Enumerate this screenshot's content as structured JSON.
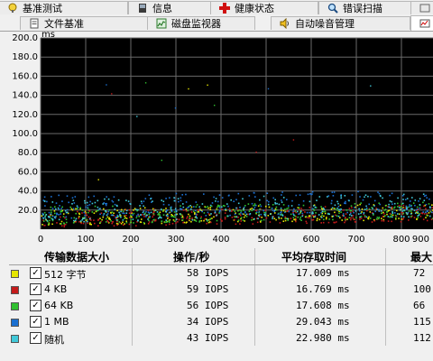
{
  "tabs_row1": [
    {
      "label": "基准测试",
      "icon": "benchmark-icon"
    },
    {
      "label": "信息",
      "icon": "info-icon"
    },
    {
      "label": "健康状态",
      "icon": "health-cross-icon"
    },
    {
      "label": "错误扫描",
      "icon": "magnifier-icon"
    },
    {
      "label": "",
      "icon": "small-tab-icon"
    }
  ],
  "tabs_row2": [
    {
      "label": "文件基准",
      "icon": "file-benchmark-icon"
    },
    {
      "label": "磁盘监视器",
      "icon": "disk-monitor-icon"
    },
    {
      "label": "自动噪音管理",
      "icon": "speaker-icon"
    },
    {
      "label": "",
      "icon": "chart-tab-icon"
    }
  ],
  "chart_data": {
    "type": "scatter",
    "ylabel": "ms",
    "ylim": [
      0,
      200
    ],
    "xlim": [
      0,
      870
    ],
    "y_ticks": [
      "200.0",
      "180.0",
      "160.0",
      "140.0",
      "120.0",
      "100.0",
      "80.0",
      "60.0",
      "40.0",
      "20.0"
    ],
    "x_ticks": [
      "0",
      "100",
      "200",
      "300",
      "400",
      "500",
      "600",
      "700",
      "800",
      "900"
    ],
    "grid": true,
    "background": "#000000",
    "series": [
      {
        "name": "512 字节",
        "color": "#e6e600",
        "y_range": [
          5,
          22
        ]
      },
      {
        "name": "4 KB",
        "color": "#c41a1a",
        "y_range": [
          3,
          20
        ]
      },
      {
        "name": "64 KB",
        "color": "#30c030",
        "y_range": [
          6,
          24
        ]
      },
      {
        "name": "1 MB",
        "color": "#1a6fd0",
        "y_range": [
          12,
          36
        ]
      },
      {
        "name": "随机",
        "color": "#40c8d8",
        "y_range": [
          8,
          32
        ]
      }
    ],
    "x_extent": [
      0,
      870
    ]
  },
  "table": {
    "headers": [
      "传输数据大小",
      "操作/秒",
      "平均存取时间",
      "最大"
    ],
    "rows": [
      {
        "label": "512 字节",
        "color": "#e6e600",
        "checked": "✓",
        "ops": "58 IOPS",
        "avg": "17.009 ms",
        "max": "72"
      },
      {
        "label": "4 KB",
        "color": "#c41a1a",
        "checked": "✓",
        "ops": "59 IOPS",
        "avg": "16.769 ms",
        "max": "100"
      },
      {
        "label": "64 KB",
        "color": "#30c030",
        "checked": "✓",
        "ops": "56 IOPS",
        "avg": "17.608 ms",
        "max": "66"
      },
      {
        "label": "1 MB",
        "color": "#1a6fd0",
        "checked": "✓",
        "ops": "34 IOPS",
        "avg": "29.043 ms",
        "max": "115"
      },
      {
        "label": "随机",
        "color": "#40c8d8",
        "checked": "✓",
        "ops": "43 IOPS",
        "avg": "22.980 ms",
        "max": "112"
      }
    ]
  }
}
